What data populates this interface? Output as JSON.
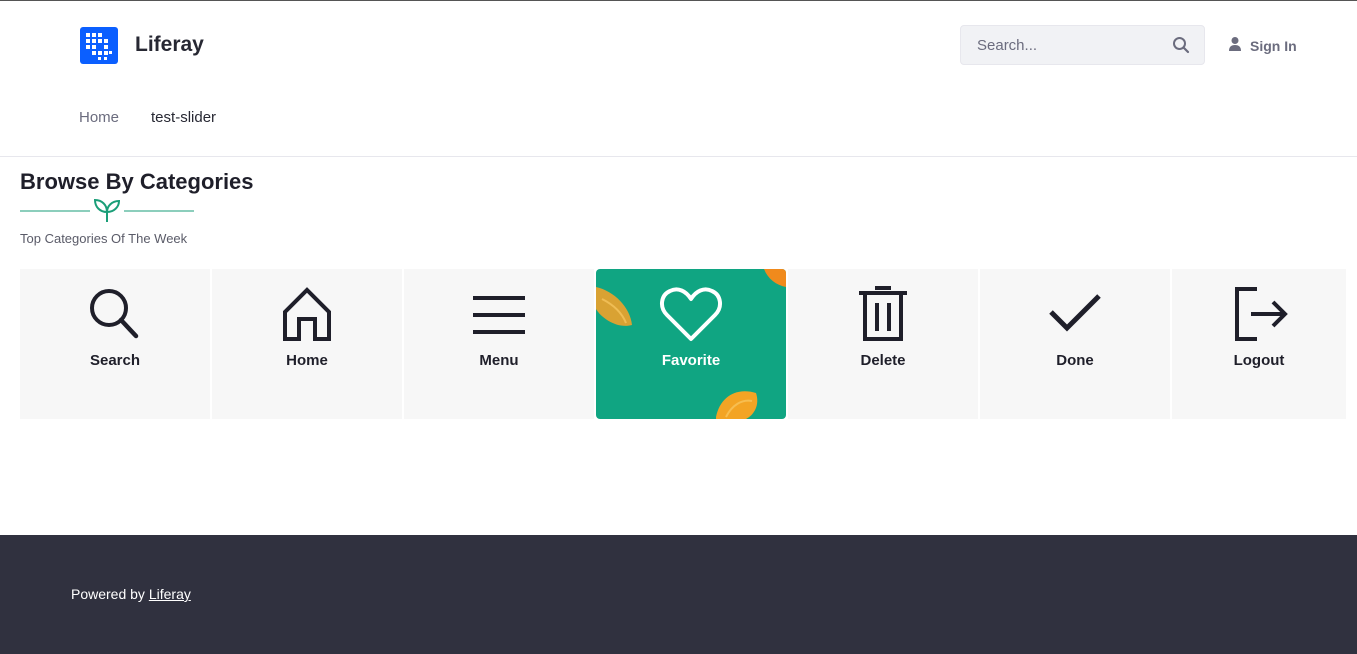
{
  "header": {
    "brand": "Liferay",
    "search_placeholder": "Search...",
    "signin_label": "Sign In"
  },
  "nav": {
    "items": [
      {
        "label": "Home"
      },
      {
        "label": "test-slider"
      }
    ]
  },
  "section": {
    "title": "Browse By Categories",
    "subtitle": "Top Categories Of The Week",
    "ornament_icon": "sprout-icon"
  },
  "categories": [
    {
      "label": "Search",
      "icon": "search-icon"
    },
    {
      "label": "Home",
      "icon": "home-icon"
    },
    {
      "label": "Menu",
      "icon": "menu-icon"
    },
    {
      "label": "Favorite",
      "icon": "heart-icon",
      "selected": true
    },
    {
      "label": "Delete",
      "icon": "trash-icon"
    },
    {
      "label": "Done",
      "icon": "check-icon"
    },
    {
      "label": "Logout",
      "icon": "logout-icon"
    }
  ],
  "colors": {
    "brand_blue": "#0b5fff",
    "accent_green": "#10a582",
    "footer_bg": "#30313f",
    "ornament_green": "#1a9e78"
  },
  "footer": {
    "powered_by": "Powered by",
    "link_label": "Liferay"
  }
}
